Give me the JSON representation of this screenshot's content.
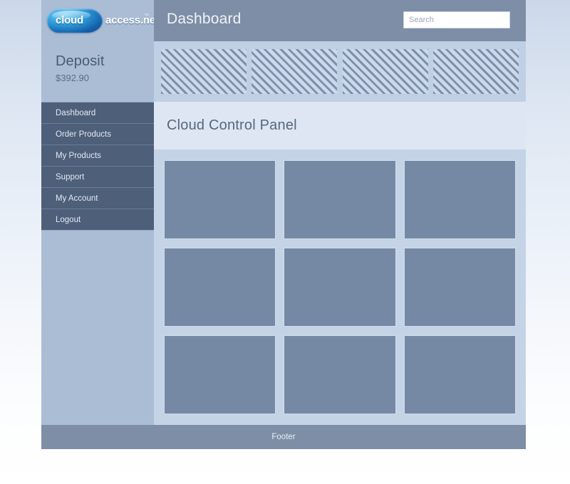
{
  "header": {
    "logo": {
      "mark_text": "cloud",
      "name_text": "access.net",
      "trademark": "™"
    },
    "title": "Dashboard",
    "search": {
      "placeholder": "Search",
      "value": ""
    }
  },
  "sidebar": {
    "deposit_label": "Deposit",
    "deposit_amount": "$392.90",
    "nav_items": [
      {
        "label": "Dashboard"
      },
      {
        "label": "Order Products"
      },
      {
        "label": "My Products"
      },
      {
        "label": "Support"
      },
      {
        "label": "My Account"
      },
      {
        "label": "Logout"
      }
    ]
  },
  "main": {
    "banner_placeholders": [
      {
        "name": "banner-1"
      },
      {
        "name": "banner-2"
      },
      {
        "name": "banner-3"
      },
      {
        "name": "banner-4"
      }
    ],
    "panel_heading": "Cloud Control Panel",
    "tiles": [
      {
        "name": "tile-1"
      },
      {
        "name": "tile-2"
      },
      {
        "name": "tile-3"
      },
      {
        "name": "tile-4"
      },
      {
        "name": "tile-5"
      },
      {
        "name": "tile-6"
      },
      {
        "name": "tile-7"
      },
      {
        "name": "tile-8"
      },
      {
        "name": "tile-9"
      }
    ]
  },
  "footer": {
    "label": "Footer"
  },
  "colors": {
    "header_bar": "#7e8ea6",
    "logo_panel": "#aabdd4",
    "nav_background": "#4e5f7a",
    "banner_strip": "#c0d0e4",
    "heading_band": "#dde6f2",
    "grid_background": "#c4d4e6",
    "tile": "#7589a5",
    "footer_bar": "#7e8ea6",
    "logo_blue": "#1463ad"
  }
}
